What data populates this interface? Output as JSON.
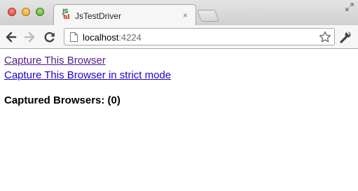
{
  "browser": {
    "tab": {
      "title": "JsTestDriver",
      "favicon_line1": "JS",
      "favicon_line2": "td",
      "close_glyph": "×"
    },
    "address_bar": {
      "host": "localhost",
      "port": ":4224"
    }
  },
  "page": {
    "links": [
      {
        "label": "Capture This Browser"
      },
      {
        "label": "Capture This Browser in strict mode"
      }
    ],
    "heading": "Captured Browsers: (0)"
  },
  "colors": {
    "visited_link": "#551a8b",
    "link": "#2200cc"
  }
}
